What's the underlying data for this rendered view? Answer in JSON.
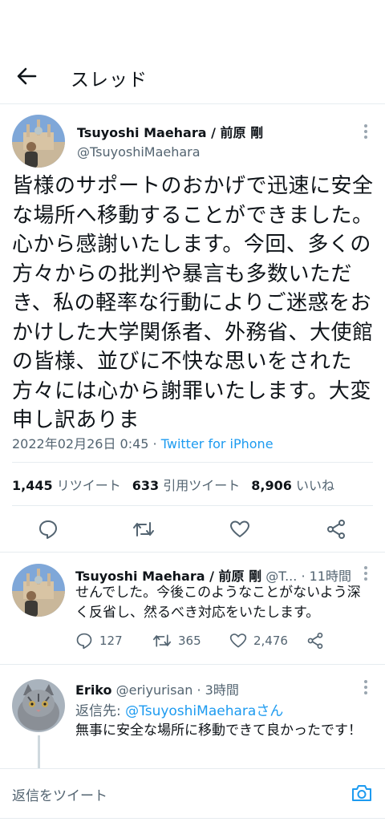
{
  "header": {
    "title": "スレッド",
    "back_icon": "arrow-left-icon"
  },
  "main_tweet": {
    "author_name": "Tsuyoshi Maehara / 前原 剛",
    "author_handle": "@TsuyoshiMaehara",
    "text": "皆様のサポートのおかげで迅速に安全な場所へ移動することができました。心から感謝いたします。今回、多くの方々からの批判や暴言も多数いただき、私の軽率な行動によりご迷惑をおかけした大学関係者、外務省、大使館の皆様、並びに不快な思いをされた方々には心から謝罪いたします。大変申し訳ありま",
    "timestamp": "2022年02月26日 0:45",
    "separator": " · ",
    "source": "Twitter for iPhone",
    "stats": {
      "retweets": "1,445",
      "retweets_label": "リツイート",
      "quotes": "633",
      "quotes_label": "引用ツイート",
      "likes": "8,906",
      "likes_label": "いいね"
    }
  },
  "reply_1": {
    "author_name": "Tsuyoshi Maehara / 前原 剛",
    "handle_truncated": "@T...",
    "time": "· 11時間",
    "text": "せんでした。今後このようなことがないよう深く反省し、然るべき対応をいたします。",
    "replies": "127",
    "retweets": "365",
    "likes": "2,476"
  },
  "reply_2": {
    "author_name": "Eriko",
    "author_handle": "@eriyurisan",
    "time": "· 3時間",
    "reply_to_label": "返信先: ",
    "reply_to_link": "@TsuyoshiMaeharaさん",
    "text": "無事に安全な場所に移動できて良かったです！"
  },
  "composer": {
    "placeholder": "返信をツイート",
    "camera_icon": "camera-icon"
  },
  "colors": {
    "accent": "#1d9bf0",
    "muted": "#536471",
    "divider": "#e6ecf0"
  }
}
